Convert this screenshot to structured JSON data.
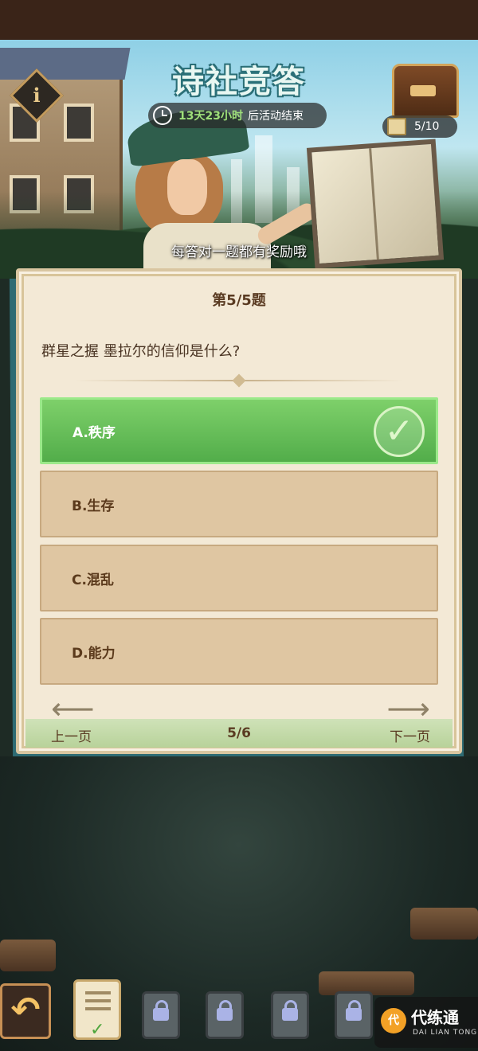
{
  "header": {
    "title": "诗社竞答",
    "info_icon": "info-icon",
    "timer_remaining": "13天23小时",
    "timer_suffix": "后活动结束",
    "progress": "5/10",
    "hint": "每答对一题都有奖励哦"
  },
  "quiz": {
    "question_number": "第5/5题",
    "question": "群星之握 墨拉尔的信仰是什么?",
    "options": [
      {
        "label": "A.秩序",
        "state": "correct"
      },
      {
        "label": "B.生存",
        "state": "default"
      },
      {
        "label": "C.混乱",
        "state": "default"
      },
      {
        "label": "D.能力",
        "state": "default"
      }
    ],
    "correct_mark": "✓"
  },
  "pagination": {
    "prev_label": "上一页",
    "next_label": "下一页",
    "page_indicator": "5/6"
  },
  "bottom_nav": {
    "back_glyph": "↶",
    "active_tab_mark": "✓"
  },
  "watermark": {
    "brand_cn": "代练通",
    "brand_en": "DAI LIAN TONG",
    "logo_glyph": "代"
  },
  "colors": {
    "correct_green": "#5cb84e",
    "option_tan": "#dfc6a2",
    "timer_green": "#9fe07a",
    "card_bg": "#f3e9d6"
  }
}
